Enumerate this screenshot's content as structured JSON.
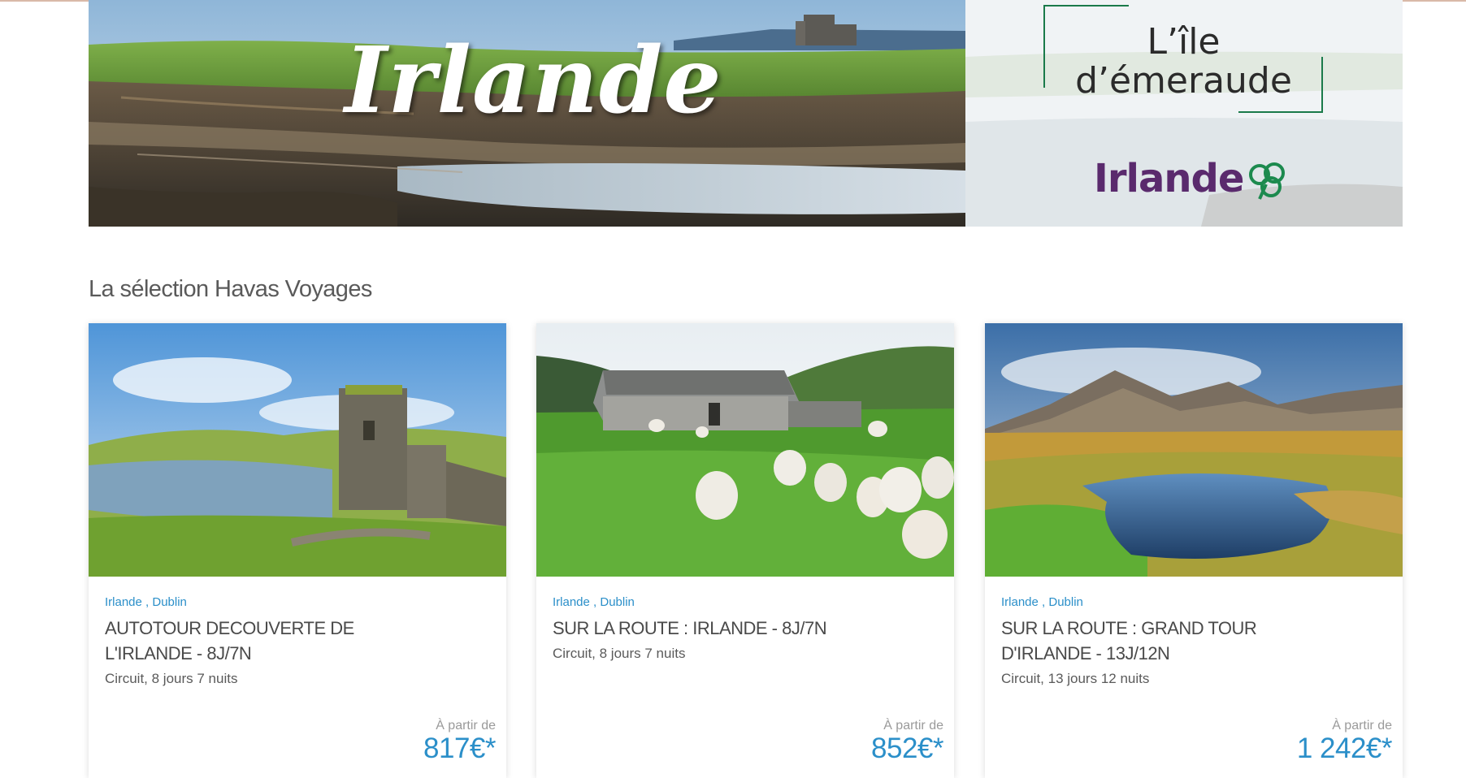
{
  "banner": {
    "title": "Irlande",
    "tagline_line1": "L’île",
    "tagline_line2": "d’émeraude",
    "brand": "Irlande",
    "brand_color": "#5a2a6d",
    "frame_color": "#1a7a4a"
  },
  "section": {
    "title": "La sélection Havas Voyages"
  },
  "accent_color": "#2b8fc9",
  "cards": [
    {
      "location": "Irlande , Dublin",
      "title_line1": "AUTOTOUR DECOUVERTE DE",
      "title_line2": "L'IRLANDE - 8J/7N",
      "subtitle": "Circuit, 8 jours 7 nuits",
      "price_from": "À partir de",
      "price": "817€*",
      "image": "castle-ruin-lake-photo"
    },
    {
      "location": "Irlande , Dublin",
      "title_line1": "SUR LA ROUTE : IRLANDE - 8J/7N",
      "title_line2": "",
      "subtitle": "Circuit, 8 jours 7 nuits",
      "price_from": "À partir de",
      "price": "852€*",
      "image": "sheep-stone-cottage-photo"
    },
    {
      "location": "Irlande , Dublin",
      "title_line1": "SUR LA ROUTE : GRAND TOUR",
      "title_line2": "D'IRLANDE - 13J/12N",
      "subtitle": "Circuit, 13 jours 12 nuits",
      "price_from": "À partir de",
      "price": "1 242€*",
      "image": "mountain-river-photo"
    }
  ]
}
